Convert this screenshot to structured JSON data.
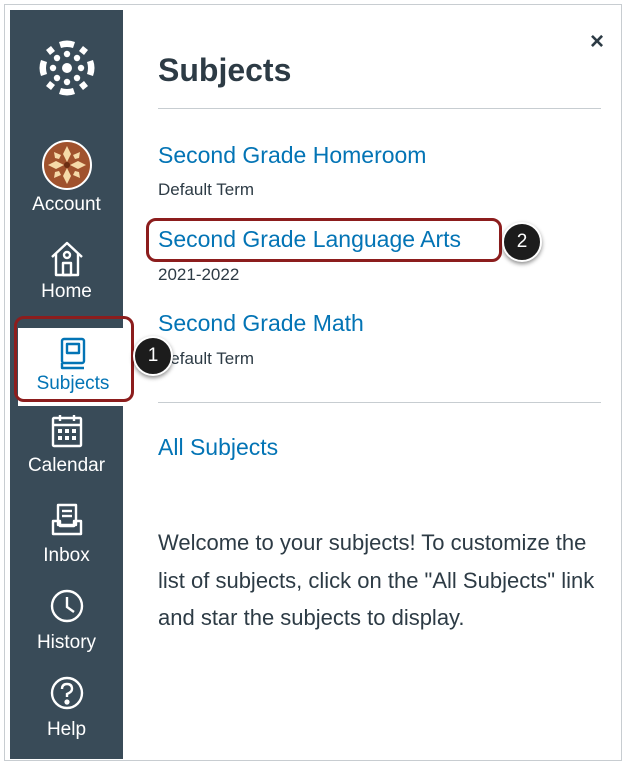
{
  "sidebar": {
    "items": [
      {
        "label": "Account",
        "icon": "avatar-icon"
      },
      {
        "label": "Home",
        "icon": "home-icon"
      },
      {
        "label": "Subjects",
        "icon": "book-icon",
        "active": true
      },
      {
        "label": "Calendar",
        "icon": "calendar-icon"
      },
      {
        "label": "Inbox",
        "icon": "inbox-icon"
      },
      {
        "label": "History",
        "icon": "clock-icon"
      },
      {
        "label": "Help",
        "icon": "help-icon"
      }
    ]
  },
  "tray": {
    "title": "Subjects",
    "close_label": "×",
    "courses": [
      {
        "name": "Second Grade Homeroom",
        "term": "Default Term"
      },
      {
        "name": "Second Grade Language Arts",
        "term": "2021-2022"
      },
      {
        "name": "Second Grade Math",
        "term": "Default Term"
      }
    ],
    "all_subjects_label": "All Subjects",
    "welcome_text": "Welcome to your subjects! To customize the list of subjects, click on the \"All Subjects\" link and star the subjects to display."
  },
  "callouts": [
    "1",
    "2"
  ],
  "colors": {
    "sidebar_bg": "#394b58",
    "link": "#0374b5",
    "text": "#2d3b45",
    "highlight": "#8c1d1d"
  }
}
